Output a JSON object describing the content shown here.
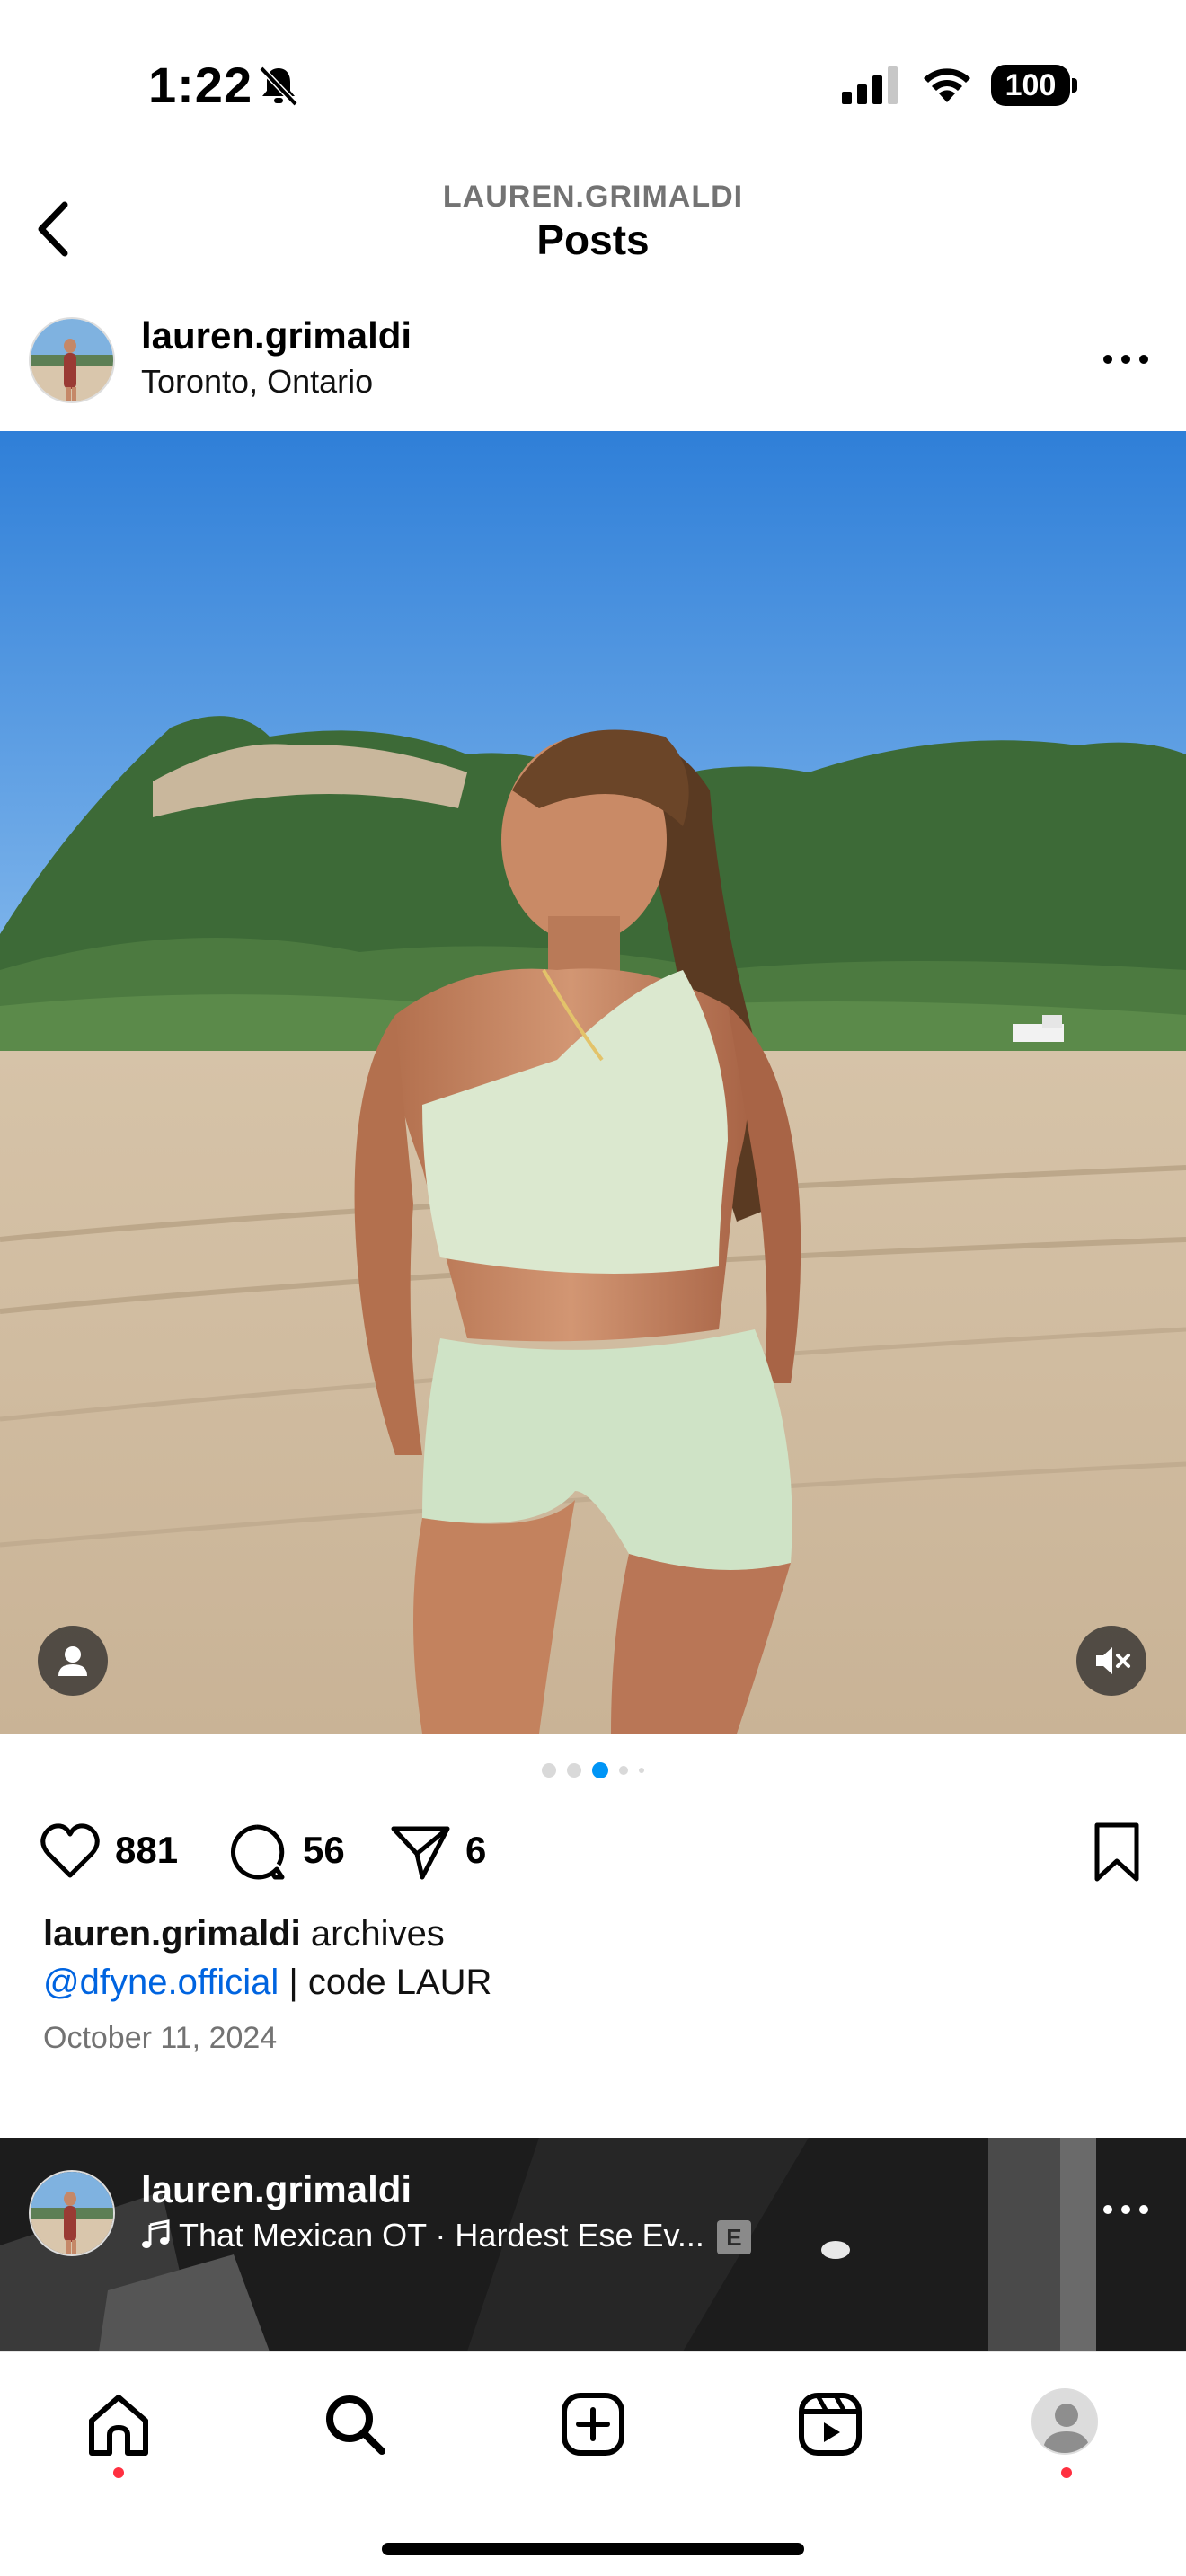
{
  "status_bar": {
    "time": "1:22",
    "battery": "100"
  },
  "nav": {
    "username": "LAUREN.GRIMALDI",
    "title": "Posts"
  },
  "post": {
    "username": "lauren.grimaldi",
    "location": "Toronto, Ontario",
    "likes": "881",
    "comments": "56",
    "shares": "6",
    "caption_user": "lauren.grimaldi",
    "caption_text": " archives",
    "caption_mention": "@dfyne.official",
    "caption_rest": " | code LAUR",
    "date": "October 11, 2024",
    "carousel_count": 5,
    "carousel_active_index": 2
  },
  "next_post": {
    "username": "lauren.grimaldi",
    "music": "That Mexican OT · Hardest Ese Ev...",
    "explicit_badge": "E"
  },
  "icons": {
    "back": "chevron-left-icon",
    "more": "more-horizontal-icon",
    "like": "heart-icon",
    "comment": "comment-icon",
    "share": "paper-plane-icon",
    "save": "bookmark-icon",
    "tag": "person-tag-icon",
    "mute": "speaker-muted-icon",
    "music": "music-note-icon"
  },
  "tabs": [
    {
      "name": "home",
      "icon": "home-icon",
      "notification": true
    },
    {
      "name": "search",
      "icon": "search-icon",
      "notification": false
    },
    {
      "name": "create",
      "icon": "plus-square-icon",
      "notification": false
    },
    {
      "name": "reels",
      "icon": "reels-icon",
      "notification": false
    },
    {
      "name": "profile",
      "icon": "profile-avatar-icon",
      "notification": true
    }
  ],
  "colors": {
    "link_blue": "#0064e0",
    "active_dot": "#0095f6",
    "notification_red": "#ff3040",
    "secondary_text": "#737373"
  }
}
